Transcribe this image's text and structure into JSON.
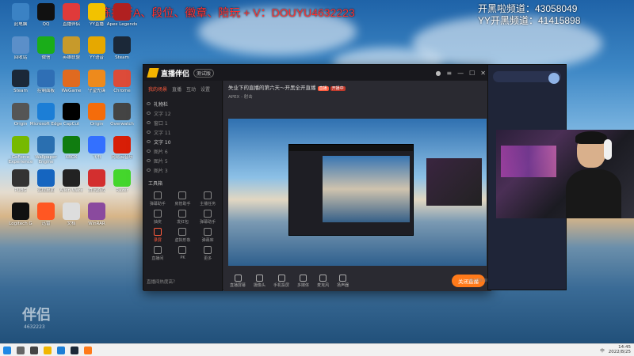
{
  "overlay": {
    "promo": "代练排行A、段位、徽章、陪玩 + V：DOUYU4632223",
    "channel_kaiheihei": "开黑啦频道：43058049",
    "channel_yy": "YY开黑频道：41415898",
    "watermark_id": "4632223"
  },
  "desktop_icons": [
    {
      "label": "此电脑",
      "color": "#3b82c4"
    },
    {
      "label": "QQ",
      "color": "#111"
    },
    {
      "label": "直播伴侣",
      "color": "#e03a3a"
    },
    {
      "label": "YY直播",
      "color": "#f2c200"
    },
    {
      "label": "Apex Legends",
      "color": "#b02020"
    },
    {
      "label": "回收站",
      "color": "#5b8fc9"
    },
    {
      "label": "微信",
      "color": "#1aad19"
    },
    {
      "label": "英雄联盟",
      "color": "#c79a2b"
    },
    {
      "label": "YY语音",
      "color": "#e6a800"
    },
    {
      "label": "Steam",
      "color": "#1b2838"
    },
    {
      "label": "Steam",
      "color": "#1b2838"
    },
    {
      "label": "控制面板",
      "color": "#2f6fb5"
    },
    {
      "label": "WeGame",
      "color": "#e06a20"
    },
    {
      "label": "守望先锋",
      "color": "#ee8a1c"
    },
    {
      "label": "Chrome",
      "color": "#dd4b39"
    },
    {
      "label": "Origin",
      "color": "#555"
    },
    {
      "label": "Microsoft Edge",
      "color": "#1c7ed6"
    },
    {
      "label": "CapCut",
      "color": "#000"
    },
    {
      "label": "Origin",
      "color": "#f56c0a"
    },
    {
      "label": "Overwatch",
      "color": "#444"
    },
    {
      "label": "GeForce Experience",
      "color": "#76b900"
    },
    {
      "label": "Wallpaper Engine",
      "color": "#2a6fb0"
    },
    {
      "label": "XBOX",
      "color": "#107c10"
    },
    {
      "label": "飞书",
      "color": "#3370ff"
    },
    {
      "label": "网易云音乐",
      "color": "#d81e06"
    },
    {
      "label": "PUBG",
      "color": "#333"
    },
    {
      "label": "远程桌面",
      "color": "#1565c0"
    },
    {
      "label": "Alien Ware",
      "color": "#222"
    },
    {
      "label": "腾讯游戏",
      "color": "#d32f2f"
    },
    {
      "label": "Razer",
      "color": "#44d62c"
    },
    {
      "label": "Logitech G",
      "color": "#111"
    },
    {
      "label": "迅雷",
      "color": "#ff5722"
    },
    {
      "label": "文档",
      "color": "#ddd"
    },
    {
      "label": "WinRAR",
      "color": "#8a4a9e"
    }
  ],
  "app": {
    "title": "直播伴侣",
    "badge": "测试版",
    "left_tabs": [
      "我的场景",
      "直播",
      "互动",
      "设置"
    ],
    "scenes": [
      "礼物栏",
      "文字 12",
      "窗口 1",
      "文字 11",
      "文字 10",
      "图片 6",
      "图片 5",
      "图片 3"
    ],
    "tools_title": "工具箱",
    "tools": [
      "弹幕助手",
      "房管助手",
      "主播任务",
      "抽奖",
      "发红包",
      "弹幕助手",
      "录屏",
      "虚拟形象",
      "弹幕库",
      "直播间",
      "PK",
      "更多"
    ],
    "stream_title": "失业下的直播的第六天～开黑全开直播",
    "stream_tag": "直播",
    "stream_game": "APEX - 射击",
    "live_label": "开播中",
    "bottom_buttons": [
      "直播屏幕",
      "摄像头",
      "手机投屏",
      "多媒体",
      "麦克风",
      "扬声器"
    ],
    "start_button": "关闭直播",
    "status_left": "直播间热度高？",
    "status_right": "00:00:00"
  },
  "taskbar": {
    "time": "14:45",
    "date": "2022/8/25",
    "ime": "中"
  }
}
